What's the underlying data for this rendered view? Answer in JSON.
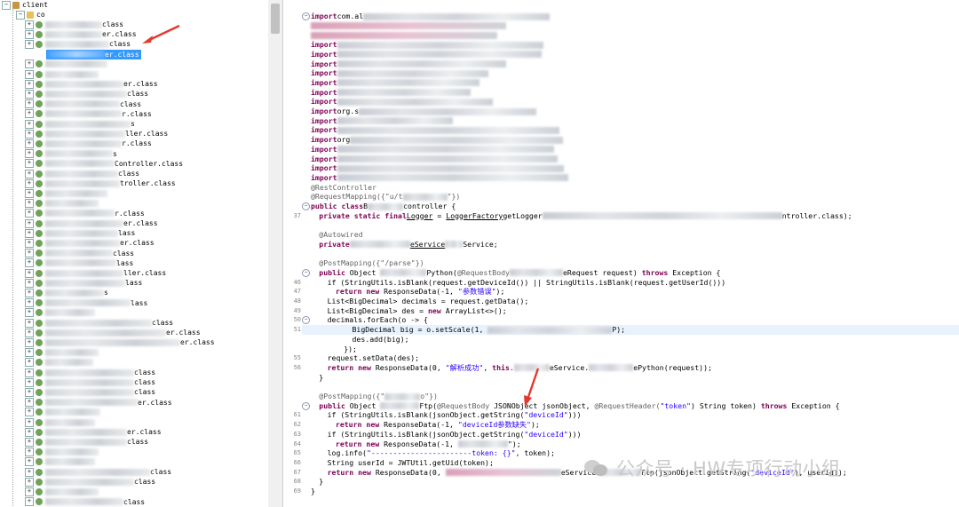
{
  "tree": {
    "root_label": "client",
    "first_package": "co",
    "rows": [
      {
        "label": "class",
        "indent": 44,
        "blur": 64
      },
      {
        "label": "er.class",
        "indent": 44,
        "blur": 64
      },
      {
        "label": "class",
        "indent": 44,
        "blur": 72
      },
      {
        "label": "er.class",
        "indent": 44,
        "blur": 64,
        "selected": true
      },
      {
        "label": "",
        "indent": 44,
        "blur": 70
      },
      {
        "label": "",
        "indent": 44,
        "blur": 60
      },
      {
        "label": "er.class",
        "indent": 44,
        "blur": 88
      },
      {
        "label": "class",
        "indent": 44,
        "blur": 92
      },
      {
        "label": "class",
        "indent": 44,
        "blur": 84
      },
      {
        "label": "r.class",
        "indent": 44,
        "blur": 86
      },
      {
        "label": "s",
        "indent": 44,
        "blur": 96
      },
      {
        "label": "ller.class",
        "indent": 44,
        "blur": 90
      },
      {
        "label": "r.class",
        "indent": 44,
        "blur": 86
      },
      {
        "label": "s",
        "indent": 44,
        "blur": 76
      },
      {
        "label": "Controller.class",
        "indent": 44,
        "blur": 78
      },
      {
        "label": "class",
        "indent": 44,
        "blur": 82
      },
      {
        "label": "troller.class",
        "indent": 44,
        "blur": 84
      },
      {
        "label": "",
        "indent": 44,
        "blur": 70
      },
      {
        "label": "",
        "indent": 44,
        "blur": 60
      },
      {
        "label": "r.class",
        "indent": 44,
        "blur": 78
      },
      {
        "label": "er.class",
        "indent": 44,
        "blur": 88
      },
      {
        "label": "lass",
        "indent": 44,
        "blur": 82
      },
      {
        "label": "er.class",
        "indent": 44,
        "blur": 84
      },
      {
        "label": "class",
        "indent": 44,
        "blur": 76
      },
      {
        "label": "lass",
        "indent": 44,
        "blur": 80
      },
      {
        "label": "ller.class",
        "indent": 44,
        "blur": 88
      },
      {
        "label": "lass",
        "indent": 44,
        "blur": 90
      },
      {
        "label": "s",
        "indent": 44,
        "blur": 66
      },
      {
        "label": "lass",
        "indent": 44,
        "blur": 96
      },
      {
        "label": "",
        "indent": 44,
        "blur": 56
      },
      {
        "label": "class",
        "indent": 44,
        "blur": 120
      },
      {
        "label": "er.class",
        "indent": 44,
        "blur": 136
      },
      {
        "label": "er.class",
        "indent": 44,
        "blur": 152
      },
      {
        "label": "",
        "indent": 44,
        "blur": 60
      },
      {
        "label": "",
        "indent": 44,
        "blur": 54
      },
      {
        "label": "class",
        "indent": 44,
        "blur": 100
      },
      {
        "label": "class",
        "indent": 44,
        "blur": 100
      },
      {
        "label": "class",
        "indent": 44,
        "blur": 100
      },
      {
        "label": "er.class",
        "indent": 44,
        "blur": 104
      },
      {
        "label": "",
        "indent": 44,
        "blur": 62
      },
      {
        "label": "",
        "indent": 44,
        "blur": 56
      },
      {
        "label": "er.class",
        "indent": 44,
        "blur": 92
      },
      {
        "label": "class",
        "indent": 44,
        "blur": 92
      },
      {
        "label": "",
        "indent": 44,
        "blur": 60
      },
      {
        "label": "",
        "indent": 44,
        "blur": 56
      },
      {
        "label": "class",
        "indent": 44,
        "blur": 118
      },
      {
        "label": "class",
        "indent": 44,
        "blur": 100
      },
      {
        "label": "",
        "indent": 44,
        "blur": 60
      },
      {
        "label": "class",
        "indent": 44,
        "blur": 88
      },
      {
        "label": "class",
        "indent": 44,
        "blur": 94
      }
    ]
  },
  "editor": {
    "imports": [
      {
        "kw": "import",
        "text": "com.al"
      },
      {
        "kw": "",
        "text": ""
      },
      {
        "kw": "",
        "text": ""
      },
      {
        "kw": "import",
        "text": ""
      },
      {
        "kw": "import",
        "text": ""
      },
      {
        "kw": "import",
        "text": ""
      },
      {
        "kw": "import",
        "text": ""
      },
      {
        "kw": "import",
        "text": ""
      },
      {
        "kw": "import",
        "text": ""
      },
      {
        "kw": "import",
        "text": ""
      },
      {
        "kw": "import",
        "text": "org.s"
      },
      {
        "kw": "import",
        "text": ""
      },
      {
        "kw": "import",
        "text": ""
      },
      {
        "kw": "import",
        "text": "org"
      },
      {
        "kw": "import",
        "text": ""
      },
      {
        "kw": "import",
        "text": ""
      },
      {
        "kw": "import",
        "text": ""
      },
      {
        "kw": "import",
        "text": ""
      }
    ],
    "rest_controller": "@RestController",
    "request_mapping_prefix": "@RequestMapping({\"u/t",
    "request_mapping_suffix": "\"})",
    "class_decl_kw": "public class",
    "class_decl_name": "B",
    "class_decl_suffix": "controller {",
    "logger_kw": "private static final",
    "logger_type": "Logger",
    "logger_var": "log",
    "logger_eq": " = ",
    "logger_factory": "LoggerFactory",
    "logger_get": "getLogger",
    "logger_tail": "ntroller.class);",
    "autowired": "@Autowired",
    "service_kw": "private",
    "service_type_suffix": "eService",
    "service_var_suffix": "Service;",
    "post_parse": "@PostMapping({\"/parse\"})",
    "parse_sig_kw": "public",
    "parse_sig_a": " Object ",
    "parse_sig_b": "Python(",
    "parse_sig_ann": "@RequestBody",
    "parse_sig_c": "eRequest request) ",
    "parse_sig_throws": "throws",
    "parse_sig_d": " Exception {",
    "if1": "if (StringUtils.isBlank(request.getDeviceId()) || StringUtils.isBlank(request.getUserId()))",
    "ret1_kw": "return new",
    "ret1_a": " ResponseData(-1, ",
    "ret1_str": "\"参数错误\"",
    "ret1_b": ");",
    "list1": "List<BigDecimal> decimals = request.getData();",
    "list2_a": "List<BigDecimal> des = ",
    "list2_kw": "new",
    "list2_b": " ArrayList<>();",
    "foreach": "decimals.forEach(o -> {",
    "bigdec_a": "BigDecimal big = o.setScale(1, ",
    "bigdec_b": "P);",
    "desadd": "des.add(big);",
    "close_lambda": "});",
    "setdata": "request.setData(des);",
    "ret2_kw": "return new",
    "ret2_a": " ResponseData(0, ",
    "ret2_str": "\"解析成功\"",
    "ret2_b": ", ",
    "ret2_this": "this",
    "ret2_c": ".",
    "ret2_d": "eService.",
    "ret2_e": "ePython(request));",
    "close1": "}",
    "post2_a": "@PostMapping({\"",
    "post2_b": "o\"})",
    "sig2_kw": "public",
    "sig2_a": " Object ",
    "sig2_b": "Ftp(",
    "sig2_ann": "@RequestBody",
    "sig2_c": " JSONObject jsonObject, ",
    "sig2_ann2": "@RequestHeader(",
    "sig2_str": "\"token\"",
    "sig2_d": ") String token) ",
    "sig2_throws": "throws",
    "sig2_e": " Exception {",
    "if2_a": "if (StringUtils.isBlank(jsonObject.getString(",
    "if2_str": "\"deviceId\"",
    "if2_b": ")))",
    "ret3_kw": "return new",
    "ret3_a": " ResponseData(-1, ",
    "ret3_str": "\"deviceId参数缺失\"",
    "ret3_b": ");",
    "ret4_kw": "return new",
    "ret4_a": " ResponseData(-1, ",
    "ret4_b": "\");",
    "log_a": "log.info(",
    "log_str": "\"-----------------------token: {}\"",
    "log_b": ", token);",
    "uid": "String userId = JWTUtil.getUid(token);",
    "ret5_kw": "return new",
    "ret5_a": " ResponseData(0, ",
    "ret5_b": "eService.",
    "ret5_c": "Ftp(jsonObject.getString(",
    "ret5_str": "\"deviceId\"",
    "ret5_d": "), userId));",
    "close2": "}",
    "close3": "}",
    "line_numbers": {
      "l37": "37",
      "l46": "46",
      "l47": "47",
      "l48": "48",
      "l49": "49",
      "l50": "50",
      "l51": "51",
      "l55": "55",
      "l56": "56",
      "l61": "61",
      "l62": "62",
      "l63": "63",
      "l64": "64",
      "l65": "65",
      "l66": "66",
      "l67": "67",
      "l68": "68",
      "l69": "69"
    }
  },
  "watermark": {
    "text": "公众号 · HW专项行动小组"
  },
  "colors": {
    "keyword": "#7f0055",
    "annotation": "#646464",
    "string": "#2a00ff",
    "arrow": "#e23a2e",
    "selection": "#3399ff"
  }
}
